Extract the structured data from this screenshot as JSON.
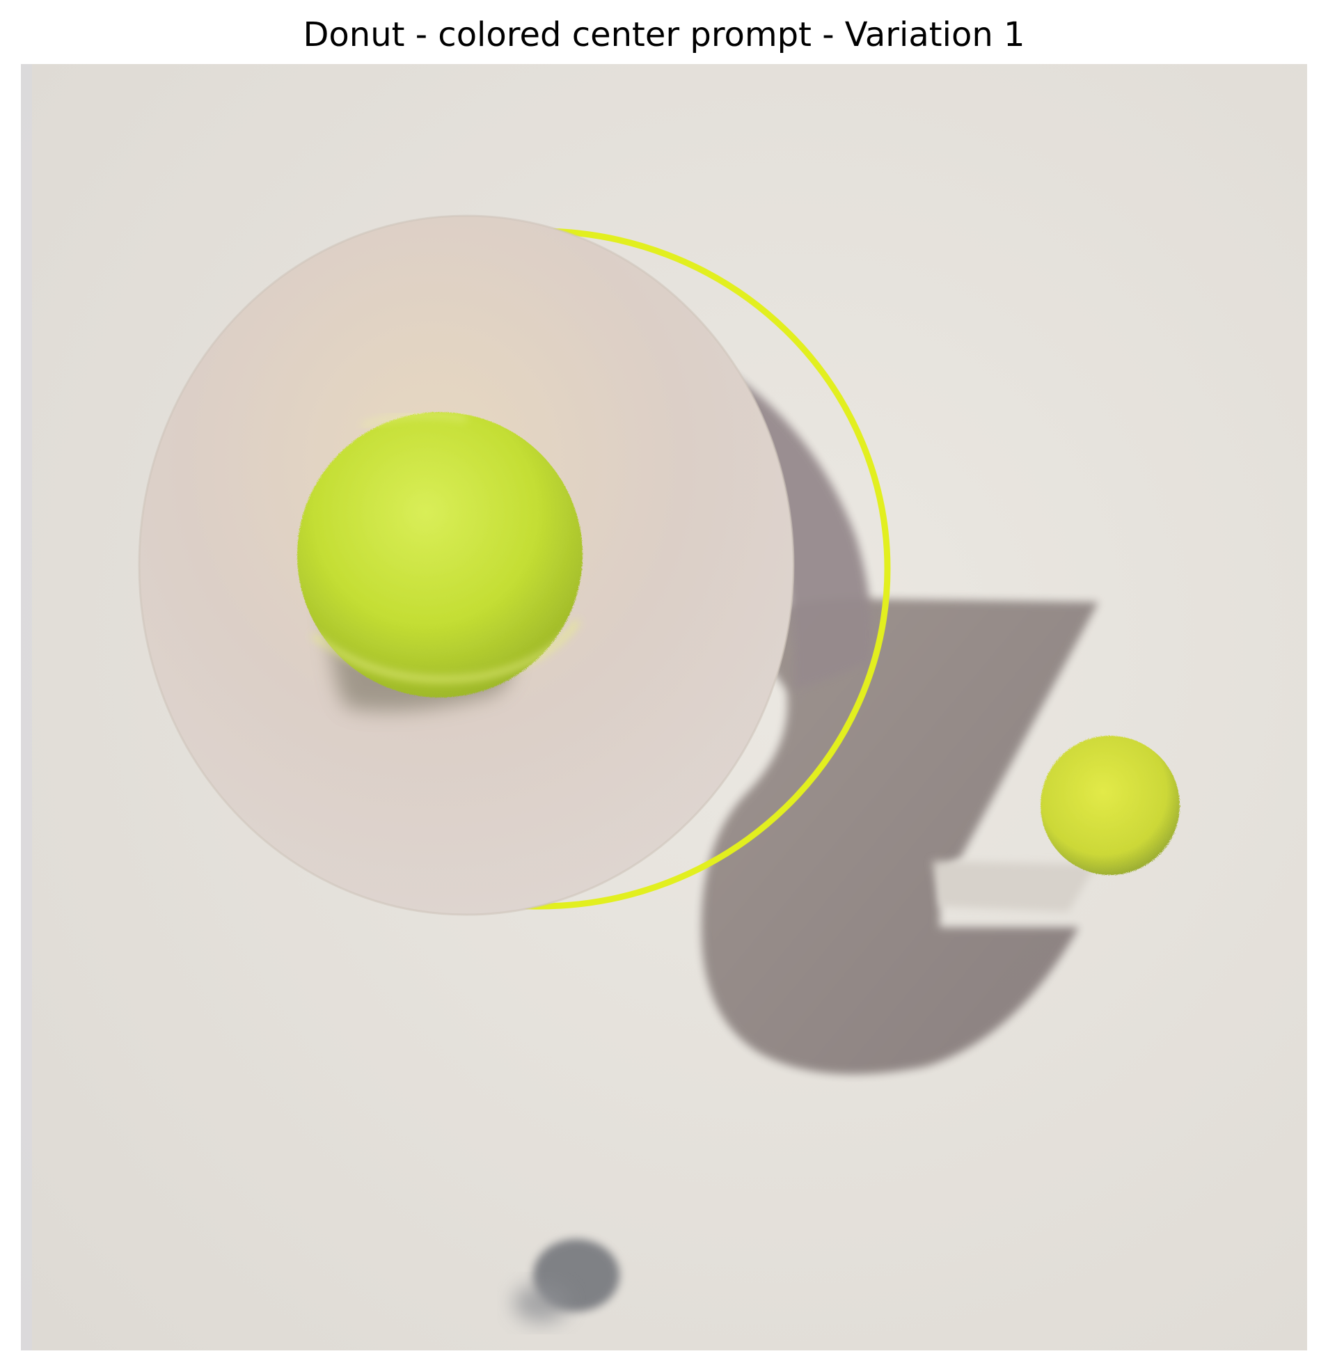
{
  "title": "Donut - colored center prompt - Variation 1",
  "image": {
    "description_tag": "generated-photo",
    "colors": {
      "background": "#e6e3dd",
      "disc": "#ddd3ca",
      "ring": "#e4f02a",
      "ball": "#c9e23a",
      "shadow": "#8e8481"
    }
  }
}
